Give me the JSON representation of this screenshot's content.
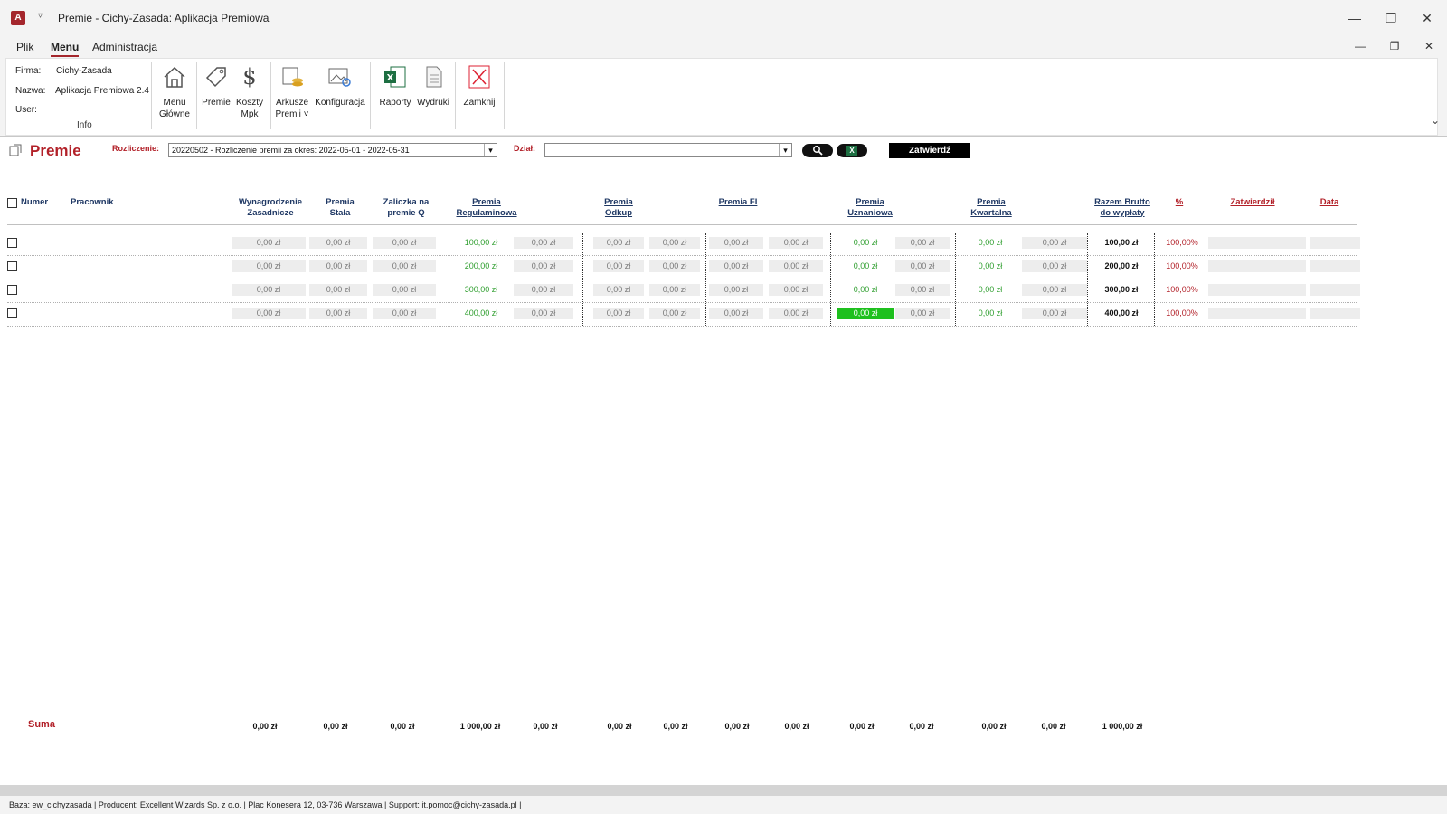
{
  "window": {
    "title": "Premie  -  Cichy-Zasada: Aplikacja Premiowa",
    "app_icon": "access-icon"
  },
  "menubar": {
    "tabs": [
      "Plik",
      "Menu",
      "Administracja"
    ],
    "active": "Menu"
  },
  "ribbon": {
    "info": {
      "firma_label": "Firma:",
      "firma_value": "Cichy-Zasada",
      "nazwa_label": "Nazwa:",
      "nazwa_value": "Aplikacja Premiowa 2.4",
      "user_label": "User:",
      "user_value": "",
      "group_label": "Info"
    },
    "buttons": {
      "menu_glowne": "Menu\nGłówne",
      "premie": "Premie",
      "koszty_mpk": "Koszty\nMpk",
      "arkusze_premii": "Arkusze\nPremii ˅",
      "konfiguracja": "Konfiguracja",
      "raporty": "Raporty",
      "wydruki": "Wydruki",
      "zamknij": "Zamknij"
    }
  },
  "form": {
    "title": "Premie",
    "rozliczenie_label": "Rozliczenie:",
    "rozliczenie_value": "20220502 - Rozliczenie premii za okres: 2022-05-01 - 2022-05-31",
    "dzial_label": "Dział:",
    "dzial_value": "",
    "zatwierdz_label": "Zatwierdź",
    "excel_label": "X"
  },
  "table": {
    "headers": {
      "numer": "Numer",
      "pracownik": "Pracownik",
      "wynagrodzenie": "Wynagrodzenie\nZasadnicze",
      "premia_stala": "Premia\nStała",
      "zaliczka": "Zaliczka na\npremie Q",
      "premia_regulaminowa": "Premia\nRegulaminowa",
      "premia_odkup": "Premia\nOdkup",
      "premia_fi": "Premia FI",
      "premia_uznaniowa": "Premia\nUznaniowa",
      "premia_kwartalna": "Premia\nKwartalna",
      "razem_brutto": "Razem Brutto\ndo wypłaty",
      "procent": "%",
      "zatwierdzil": "Zatwierdził",
      "data": "Data"
    },
    "rows": [
      {
        "wyn": "0,00 zł",
        "stala": "0,00 zł",
        "zal": "0,00 zł",
        "reg": "100,00 zł",
        "reg2": "0,00 zł",
        "odk1": "0,00 zł",
        "odk2": "0,00 zł",
        "fi1": "0,00 zł",
        "fi2": "0,00 zł",
        "uzn1": "0,00 zł",
        "uzn2": "0,00 zł",
        "kw1": "0,00 zł",
        "kw2": "0,00 zł",
        "razem": "100,00 zł",
        "pct": "100,00%"
      },
      {
        "wyn": "0,00 zł",
        "stala": "0,00 zł",
        "zal": "0,00 zł",
        "reg": "200,00 zł",
        "reg2": "0,00 zł",
        "odk1": "0,00 zł",
        "odk2": "0,00 zł",
        "fi1": "0,00 zł",
        "fi2": "0,00 zł",
        "uzn1": "0,00 zł",
        "uzn2": "0,00 zł",
        "kw1": "0,00 zł",
        "kw2": "0,00 zł",
        "razem": "200,00 zł",
        "pct": "100,00%"
      },
      {
        "wyn": "0,00 zł",
        "stala": "0,00 zł",
        "zal": "0,00 zł",
        "reg": "300,00 zł",
        "reg2": "0,00 zł",
        "odk1": "0,00 zł",
        "odk2": "0,00 zł",
        "fi1": "0,00 zł",
        "fi2": "0,00 zł",
        "uzn1": "0,00 zł",
        "uzn2": "0,00 zł",
        "kw1": "0,00 zł",
        "kw2": "0,00 zł",
        "razem": "300,00 zł",
        "pct": "100,00%"
      },
      {
        "wyn": "0,00 zł",
        "stala": "0,00 zł",
        "zal": "0,00 zł",
        "reg": "400,00 zł",
        "reg2": "0,00 zł",
        "odk1": "0,00 zł",
        "odk2": "0,00 zł",
        "fi1": "0,00 zł",
        "fi2": "0,00 zł",
        "uzn1": "0,00 zł",
        "uzn2": "0,00 zł",
        "kw1": "0,00 zł",
        "kw2": "0,00 zł",
        "razem": "400,00 zł",
        "pct": "100,00%"
      }
    ],
    "focused_cell": "rows.3.uzn1"
  },
  "summary": {
    "label": "Suma",
    "values": [
      "0,00 zł",
      "0,00 zł",
      "0,00 zł",
      "1 000,00 zł",
      "0,00 zł",
      "0,00 zł",
      "0,00 zł",
      "0,00 zł",
      "0,00 zł",
      "0,00 zł",
      "0,00 zł",
      "0,00 zł",
      "0,00 zł",
      "1 000,00 zł"
    ]
  },
  "statusbar": {
    "text": "Baza: ew_cichyzasada | Producent: Excellent Wizards Sp. z o.o. | Plac Konesera 12, 03-736 Warszawa | Support: it.pomoc@cichy-zasada.pl |"
  },
  "colors": {
    "accent_red": "#b22028",
    "header_blue": "#1f3864",
    "value_green": "#2e9e2e",
    "highlight_green": "#1ec01e"
  }
}
